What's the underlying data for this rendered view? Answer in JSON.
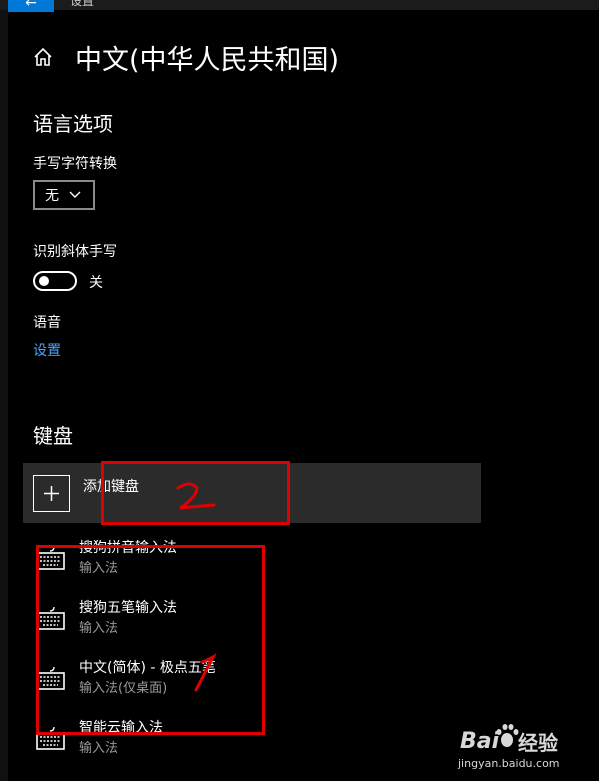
{
  "window": {
    "title": "设置",
    "back_icon": "arrow-left-icon"
  },
  "page": {
    "title": "中文(中华人民共和国)",
    "home_icon": "home-icon"
  },
  "language_options": {
    "title": "语言选项",
    "handwriting_label": "手写字符转换",
    "handwriting_value": "无",
    "italic_label": "识别斜体手写",
    "italic_toggle_state": "关",
    "speech_label": "语音",
    "speech_link": "设置"
  },
  "keyboard": {
    "title": "键盘",
    "add_label": "添加键盘",
    "items": [
      {
        "name": "搜狗拼音输入法",
        "type": "输入法"
      },
      {
        "name": "搜狗五笔输入法",
        "type": "输入法"
      },
      {
        "name": "中文(简体) - 极点五笔",
        "type": "输入法(仅桌面)"
      },
      {
        "name": "智能云输入法",
        "type": "输入法"
      }
    ]
  },
  "annotations": {
    "mark_1": "1",
    "mark_2": "2",
    "color": "#e00000"
  },
  "watermark": {
    "brand": "经验",
    "url": "jingyan.baidu.com"
  }
}
